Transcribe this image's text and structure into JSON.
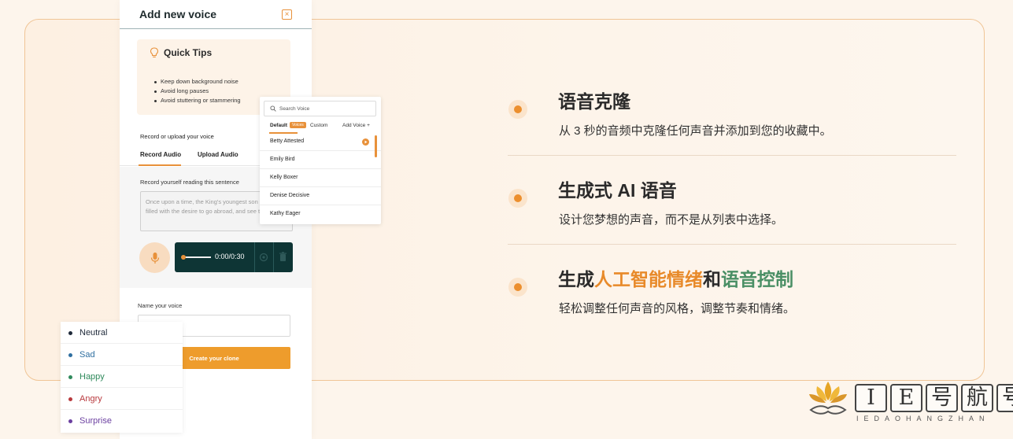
{
  "modal": {
    "title": "Add new voice",
    "close_icon": "close-icon",
    "tips": {
      "title": "Quick Tips",
      "items": [
        "Keep down background noise",
        "Avoid long pauses",
        "Avoid stuttering or stammering"
      ]
    },
    "record_label": "Record or upload your voice",
    "tabs": [
      "Record Audio",
      "Upload Audio"
    ],
    "record_sentence_label": "Record yourself reading this sentence",
    "sentence": "Once upon a time, the King's youngest son became filled with the desire to go abroad, and see the world.",
    "player_time": "0:00/0:30",
    "progress": 0,
    "name_label": "Name your voice",
    "name_value": "",
    "create_button": "Create your clone"
  },
  "voice_dropdown": {
    "search_placeholder": "Search Voice",
    "filters": {
      "default": "Default",
      "badge": "Voices",
      "custom": "Custom",
      "add": "Add Voice +"
    },
    "voices": [
      "Betty Attested",
      "Emily Bird",
      "Kelly Boxer",
      "Denise Decisive",
      "Kathy Eager"
    ]
  },
  "emotions": [
    {
      "label": "Neutral",
      "color": "#1f2a3a"
    },
    {
      "label": "Sad",
      "color": "#2f6fa0"
    },
    {
      "label": "Happy",
      "color": "#2f8a5c"
    },
    {
      "label": "Angry",
      "color": "#b8393d"
    },
    {
      "label": "Surprise",
      "color": "#6b3fa0"
    }
  ],
  "features": [
    {
      "title": "语音克隆",
      "desc": "从 3 秒的音频中克隆任何声音并添加到您的收藏中。"
    },
    {
      "title": "生成式 AI 语音",
      "desc": "设计您梦想的声音，而不是从列表中选择。"
    },
    {
      "title_parts": [
        "生成",
        "人工智能情绪",
        "和",
        "语音控制"
      ],
      "desc": "轻松调整任何声音的风格，调整节奏和情绪。"
    }
  ],
  "accent_color": "#ec8f2e",
  "dark_color": "#0e3535",
  "watermark": {
    "main": [
      "I",
      "E",
      "号",
      "航",
      "号"
    ],
    "sub": "IEDAOHANGZHAN"
  }
}
